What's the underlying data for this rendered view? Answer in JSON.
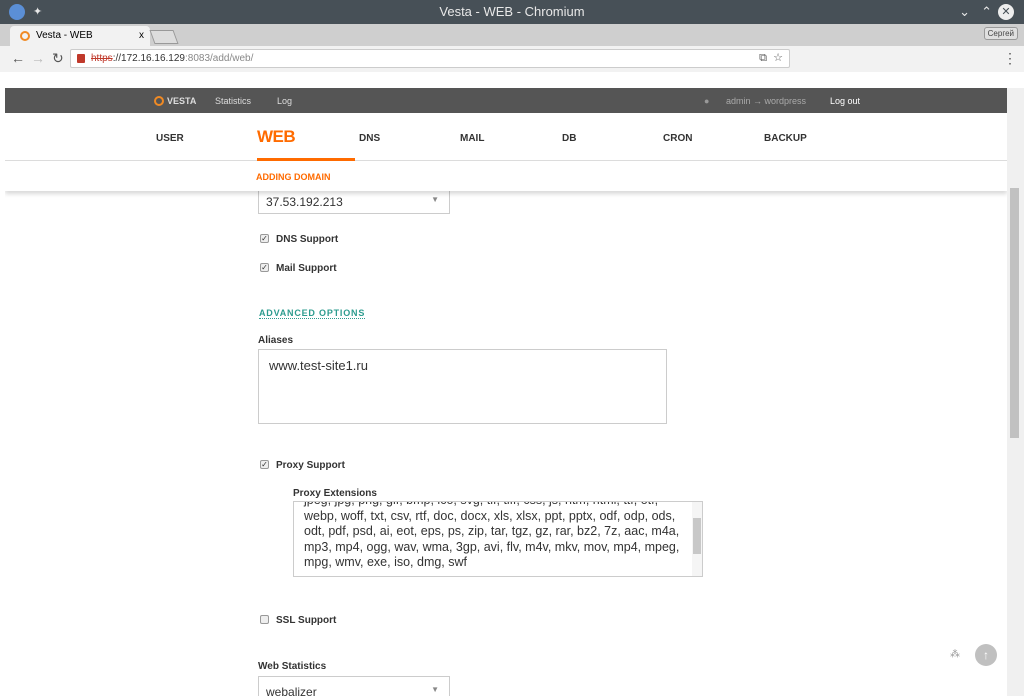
{
  "window": {
    "title": "Vesta - WEB - Chromium"
  },
  "tab": {
    "title": "Vesta - WEB",
    "close": "x"
  },
  "profile": "Сергей",
  "url": {
    "scheme": "https",
    "host": "://172.16.16.129",
    "rest": ":8083/add/web/"
  },
  "topnav": {
    "logo": "VESTA",
    "statistics": "Statistics",
    "log": "Log",
    "user": "admin → wordpress",
    "logout": "Log out"
  },
  "menu": [
    "USER",
    "WEB",
    "DNS",
    "MAIL",
    "DB",
    "CRON",
    "BACKUP"
  ],
  "subtitle": "ADDING DOMAIN",
  "form": {
    "ip": "37.53.192.213",
    "dns": "DNS Support",
    "mail": "Mail Support",
    "advanced": "ADVANCED OPTIONS",
    "aliases_label": "Aliases",
    "aliases": "www.test-site1.ru",
    "proxy": "Proxy Support",
    "proxy_ext_label": "Proxy Extensions",
    "proxy_ext": "jpeg, jpg, png, gif, bmp, ico, svg, tif, tiff, css, js, htm, html, ttf, otf, webp, woff, txt, csv, rtf, doc, docx, xls, xlsx, ppt, pptx, odf, odp, ods, odt, pdf, psd, ai, eot, eps, ps, zip, tar, tgz, gz, rar, bz2, 7z, aac, m4a, mp3, mp4, ogg, wav, wma, 3gp, avi, flv, m4v, mkv, mov, mp4, mpeg, mpg, wmv, exe, iso, dmg, swf",
    "ssl": "SSL Support",
    "stats_label": "Web Statistics",
    "stats": "webalizer"
  }
}
